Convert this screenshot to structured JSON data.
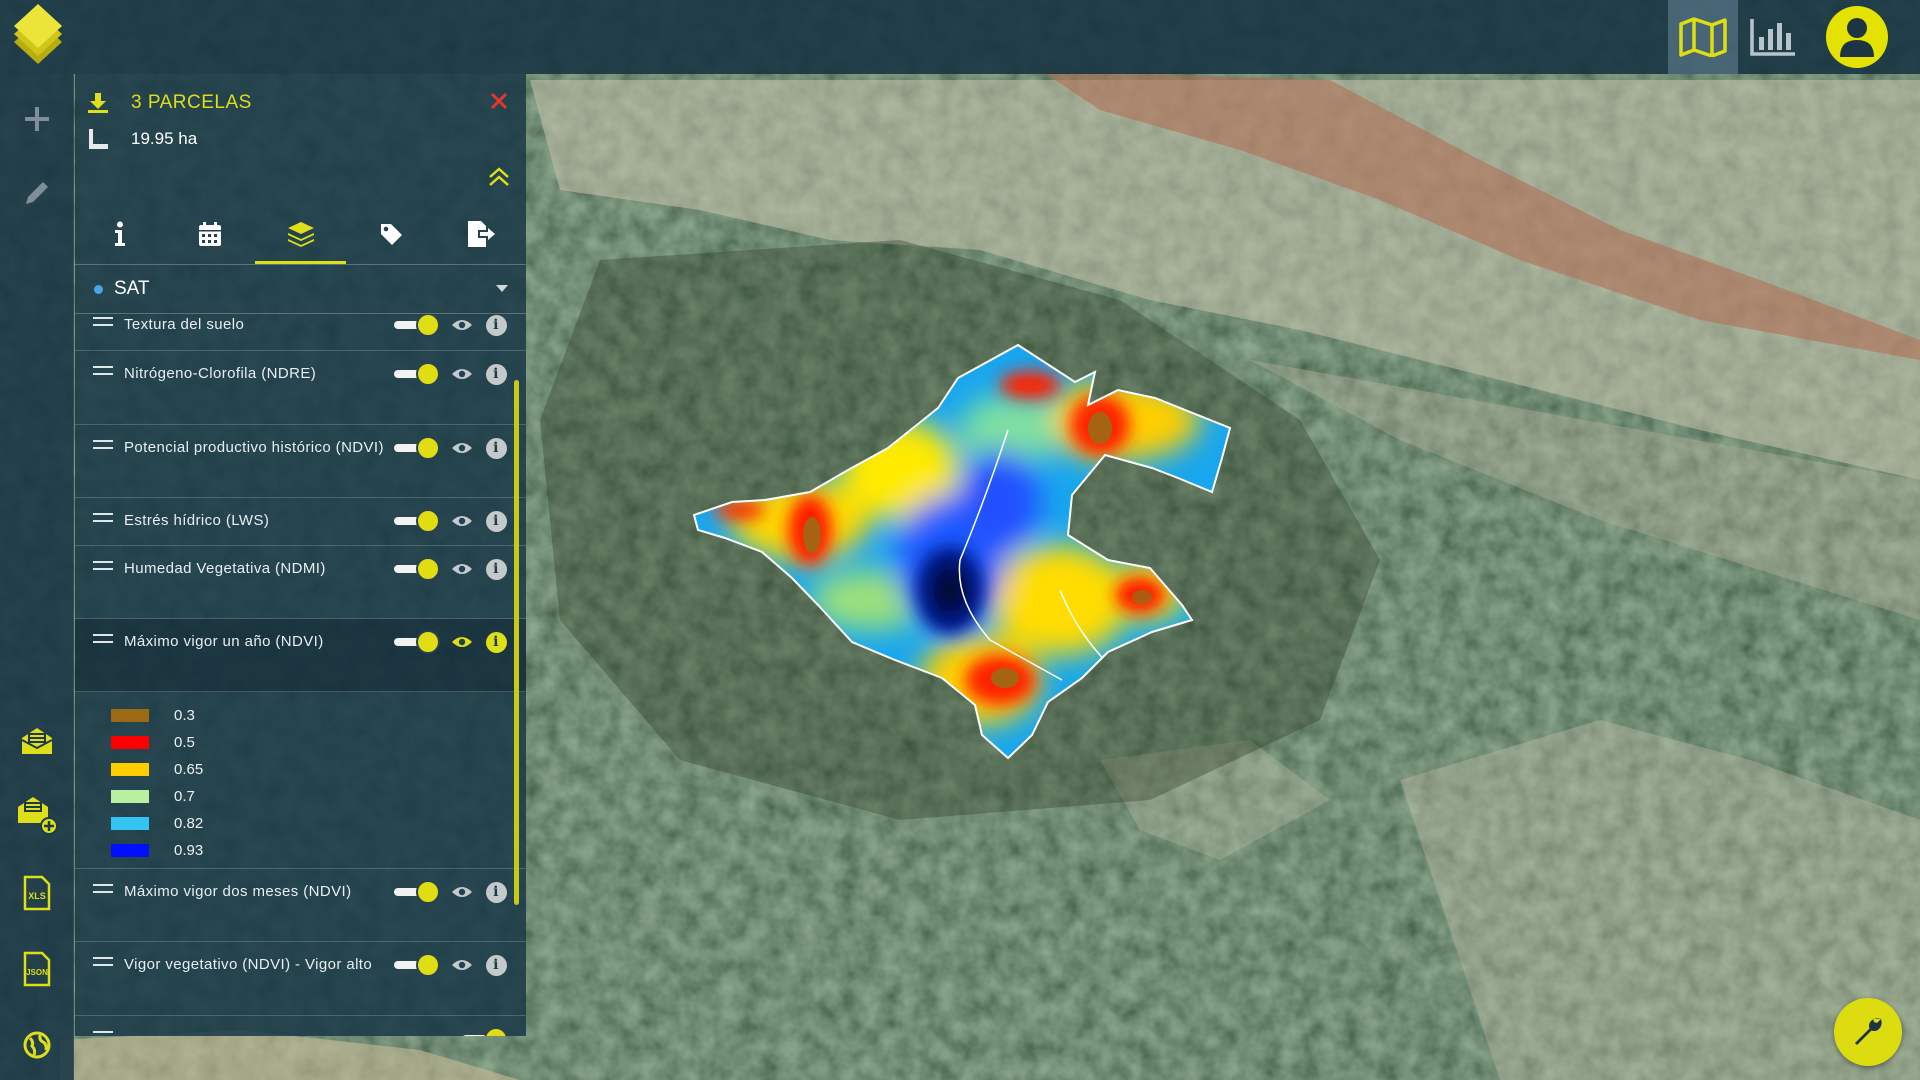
{
  "header": {
    "logo_icon": "layers-logo",
    "map_view_icon": "map-icon",
    "chart_view_icon": "chart-icon",
    "user_icon": "user-icon"
  },
  "rail": {
    "items": [
      {
        "name": "add-icon"
      },
      {
        "name": "edit-icon"
      },
      {
        "name": "mail-icon"
      },
      {
        "name": "mail-add-icon"
      },
      {
        "name": "xls-icon",
        "label": "XLS"
      },
      {
        "name": "json-icon",
        "label": "JSON"
      },
      {
        "name": "globe-icon"
      }
    ]
  },
  "panel": {
    "title": "3 PARCELAS",
    "area": "19.95 ha",
    "tabs": [
      {
        "name": "info-icon"
      },
      {
        "name": "calendar-icon"
      },
      {
        "name": "layers-icon",
        "active": true
      },
      {
        "name": "tag-icon"
      },
      {
        "name": "export-icon"
      }
    ],
    "source": {
      "label": "SAT",
      "dot_color": "#45a7ea"
    },
    "layers": [
      {
        "label": "Textura del suelo"
      },
      {
        "label": "Nitrógeno-Clorofila (NDRE)"
      },
      {
        "label": "Potencial productivo histórico (NDVI)"
      },
      {
        "label": "Estrés hídrico (LWS)"
      },
      {
        "label": "Humedad Vegetativa (NDMI)"
      },
      {
        "label": "Máximo vigor un año (NDVI)",
        "selected": true
      },
      {
        "label": "Máximo vigor dos meses (NDVI)"
      },
      {
        "label": "Vigor vegetativo (NDVI) - Vigor alto"
      }
    ],
    "legend": [
      {
        "value": "0.3",
        "color": "#9c6a14"
      },
      {
        "value": "0.5",
        "color": "#ff0000"
      },
      {
        "value": "0.65",
        "color": "#ffcc00"
      },
      {
        "value": "0.7",
        "color": "#b8f0a0"
      },
      {
        "value": "0.82",
        "color": "#33c4f4"
      },
      {
        "value": "0.93",
        "color": "#0010ff"
      }
    ]
  },
  "colors": {
    "accent": "#dede19",
    "panel_bg": "#193746",
    "close": "#e8342e"
  },
  "fab": {
    "icon": "wrench-icon"
  }
}
